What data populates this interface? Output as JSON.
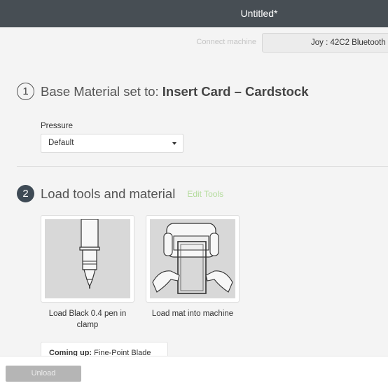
{
  "window": {
    "title": "Untitled*"
  },
  "connect": {
    "label": "Connect machine",
    "machine": "Joy : 42C2 Bluetooth"
  },
  "step1": {
    "number": "1",
    "prefix": "Base Material set to:",
    "material": "Insert Card – Cardstock"
  },
  "pressure": {
    "label": "Pressure",
    "value": "Default"
  },
  "step2": {
    "number": "2",
    "title": "Load tools and material",
    "edit_tools": "Edit Tools"
  },
  "tools": [
    {
      "caption": "Load Black 0.4 pen in clamp",
      "icon": "pen-icon"
    },
    {
      "caption": "Load mat into machine",
      "icon": "machine-mat-icon"
    }
  ],
  "coming_up": {
    "label": "Coming up:",
    "value": "Fine-Point Blade"
  },
  "footer": {
    "unload_label": "Unload"
  },
  "colors": {
    "titlebar": "#474e54",
    "step_badge": "#3e4a55",
    "edit_tools": "#b4dc9c",
    "unload_button": "#b5b5b5"
  }
}
